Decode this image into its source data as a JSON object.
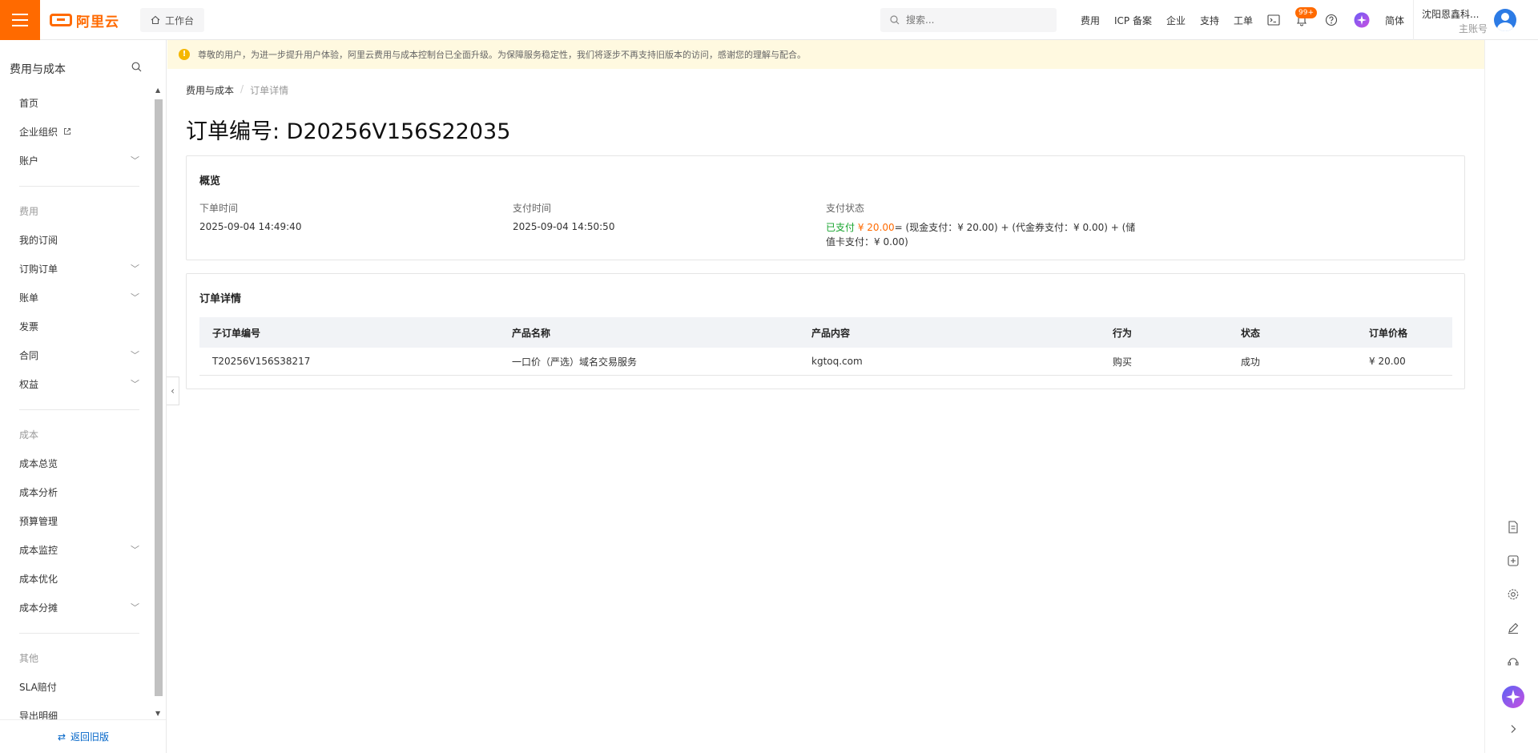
{
  "header": {
    "workbench_label": "工作台",
    "search_placeholder": "搜索...",
    "nav": [
      "费用",
      "ICP 备案",
      "企业",
      "支持",
      "工单"
    ],
    "notification_badge": "99+",
    "language": "简体",
    "user_name": "沈阳恩鑫科...",
    "user_role": "主账号"
  },
  "sidebar": {
    "title": "费用与成本",
    "items_top": [
      {
        "label": "首页",
        "chevron": false
      },
      {
        "label": "企业组织",
        "chevron": false,
        "external": true
      },
      {
        "label": "账户",
        "chevron": true
      }
    ],
    "group_fee": "费用",
    "items_fee": [
      {
        "label": "我的订阅",
        "chevron": false
      },
      {
        "label": "订购订单",
        "chevron": true
      },
      {
        "label": "账单",
        "chevron": true
      },
      {
        "label": "发票",
        "chevron": false
      },
      {
        "label": "合同",
        "chevron": true
      },
      {
        "label": "权益",
        "chevron": true
      }
    ],
    "group_cost": "成本",
    "items_cost": [
      {
        "label": "成本总览",
        "chevron": false
      },
      {
        "label": "成本分析",
        "chevron": false
      },
      {
        "label": "预算管理",
        "chevron": false
      },
      {
        "label": "成本监控",
        "chevron": true
      },
      {
        "label": "成本优化",
        "chevron": false
      },
      {
        "label": "成本分摊",
        "chevron": true
      }
    ],
    "group_other": "其他",
    "items_other": [
      {
        "label": "SLA赔付",
        "chevron": false
      },
      {
        "label": "导出明细",
        "chevron": false
      }
    ],
    "back_label": "返回旧版"
  },
  "notice": "尊敬的用户，为进一步提升用户体验，阿里云费用与成本控制台已全面升级。为保障服务稳定性，我们将逐步不再支持旧版本的访问，感谢您的理解与配合。",
  "breadcrumb": {
    "root": "费用与成本",
    "current": "订单详情"
  },
  "page_title": "订单编号: D20256V156S22035",
  "overview": {
    "title": "概览",
    "order_time_label": "下单时间",
    "order_time": "2025-09-04 14:49:40",
    "pay_time_label": "支付时间",
    "pay_time": "2025-09-04 14:50:50",
    "pay_status_label": "支付状态",
    "paid_text": "已支付",
    "paid_amount": "¥ 20.00",
    "pay_breakdown": "= (现金支付：¥ 20.00) + (代金券支付：¥ 0.00) + (储值卡支付：¥ 0.00)"
  },
  "details": {
    "title": "订单详情",
    "columns": [
      "子订单编号",
      "产品名称",
      "产品内容",
      "行为",
      "状态",
      "订单价格"
    ],
    "rows": [
      [
        "T20256V156S38217",
        "一口价（严选）域名交易服务",
        "kgtoq.com",
        "购买",
        "成功",
        "¥ 20.00"
      ]
    ]
  }
}
